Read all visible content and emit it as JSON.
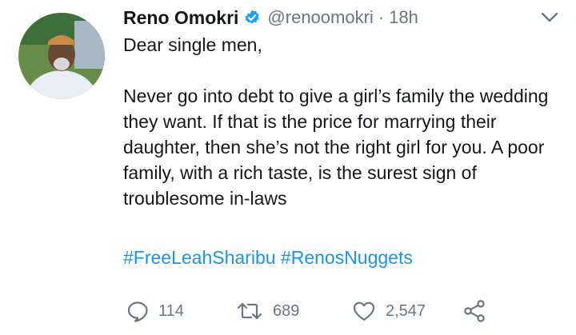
{
  "tweet": {
    "author_name": "Reno Omokri",
    "handle": "@renoomokri",
    "separator": "·",
    "time": "18h",
    "verified": true,
    "lines": [
      "Dear single men,",
      "Never go into debt to give a girl’s family the wedding they want. If that is the price for marrying their daughter, then she’s not the right girl for you. A poor family, with a rich taste, is the surest sign of troublesome in-laws"
    ],
    "hashtags": [
      "#FreeLeahSharibu",
      "#RenosNuggets"
    ]
  },
  "actions": {
    "reply_count": "114",
    "retweet_count": "689",
    "like_count": "2,547"
  },
  "icons": {
    "verified": "verified-badge-icon",
    "menu": "chevron-down-icon",
    "reply": "reply-icon",
    "retweet": "retweet-icon",
    "like": "heart-icon",
    "share": "share-icon"
  },
  "colors": {
    "text": "#14171a",
    "muted": "#657786",
    "link": "#1b95e0",
    "verified": "#1da1f2"
  }
}
